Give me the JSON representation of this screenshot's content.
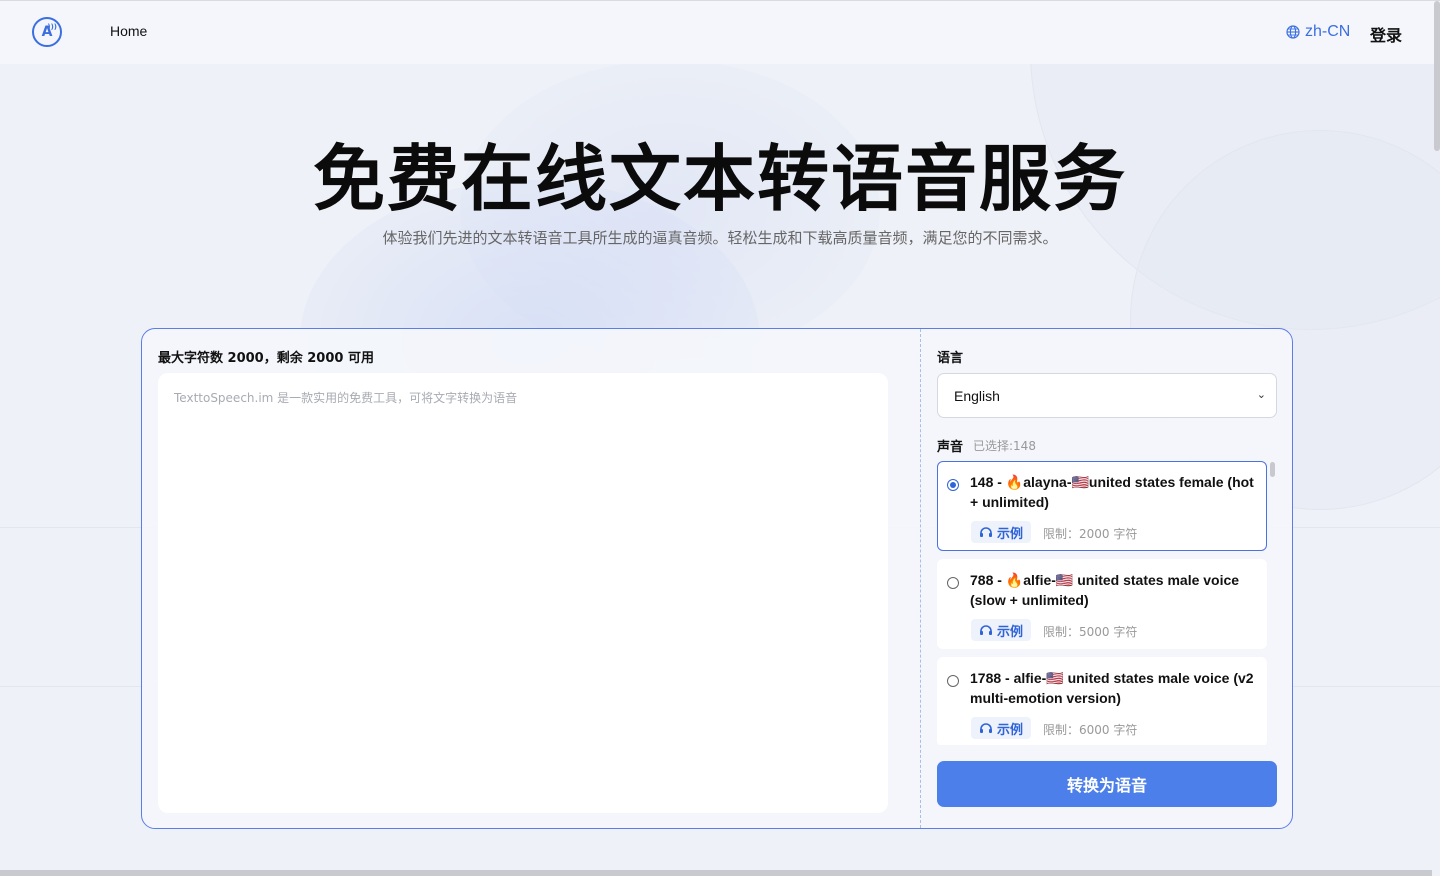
{
  "header": {
    "logo_text": "A",
    "nav_home": "Home",
    "locale": "zh-CN",
    "login": "登录"
  },
  "hero": {
    "title": "免费在线文本转语音服务",
    "subtitle": "体验我们先进的文本转语音工具所生成的逼真音频。轻松生成和下载高质量音频，满足您的不同需求。"
  },
  "editor": {
    "char_count": "最大字符数 2000，剩余 2000 可用",
    "placeholder": "TexttoSpeech.im 是一款实用的免费工具，可将文字转换为语音",
    "value": ""
  },
  "settings": {
    "language_label": "语言",
    "language_value": "English",
    "voice_label": "声音",
    "voice_selected": "已选择:148",
    "voices": [
      {
        "name": "148 - 🔥alayna-🇺🇸united states female (hot + unlimited)",
        "sample": "示例",
        "limit": "限制：2000 字符",
        "selected": true
      },
      {
        "name": "788 - 🔥alfie-🇺🇸 united states male voice (slow + unlimited)",
        "sample": "示例",
        "limit": "限制：5000 字符",
        "selected": false
      },
      {
        "name": "1788 - alfie-🇺🇸 united states male voice (v2 multi-emotion version)",
        "sample": "示例",
        "limit": "限制：6000 字符",
        "selected": false
      }
    ],
    "convert_button": "转换为语音"
  },
  "colors": {
    "accent": "#4c7fe9",
    "brand": "#3b6fe0",
    "panel_border": "#5b7de8"
  }
}
